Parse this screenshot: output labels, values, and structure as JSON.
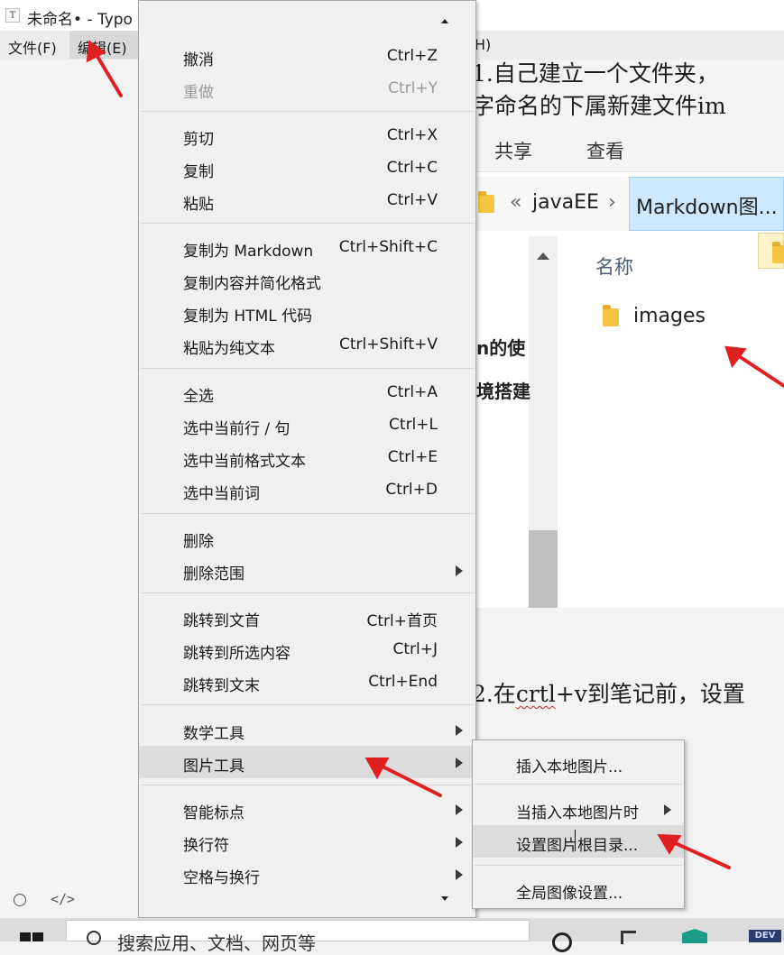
{
  "window": {
    "title": "未命名• - Typo",
    "app_icon_glyph": "T"
  },
  "menubar": {
    "items": [
      "文件(F)",
      "编辑(E)"
    ],
    "partial_item": "H)"
  },
  "document": {
    "line1": "1.自己建立一个文件夹，",
    "line1b": "字命名的下属新建文件im",
    "line2_prefix": "2.在",
    "line2_word": "crtl",
    "line2_suffix": "+v到笔记前，设置",
    "behind_text_1": "n的使",
    "behind_text_2": "境搭建"
  },
  "explorer": {
    "tabs": [
      "共享",
      "查看"
    ],
    "address_chevron": "«",
    "address_parent": "javaEE",
    "address_sep": "›",
    "address_current": "Markdown图...",
    "column_name": "名称",
    "folder_name": "images"
  },
  "context_menu": {
    "scroll_up": "▲",
    "scroll_down": "▼",
    "groups": [
      [
        {
          "label": "撤消",
          "shortcut": "Ctrl+Z"
        },
        {
          "label": "重做",
          "shortcut": "Ctrl+Y",
          "disabled": true
        }
      ],
      [
        {
          "label": "剪切",
          "shortcut": "Ctrl+X"
        },
        {
          "label": "复制",
          "shortcut": "Ctrl+C"
        },
        {
          "label": "粘贴",
          "shortcut": "Ctrl+V"
        }
      ],
      [
        {
          "label": "复制为 Markdown",
          "shortcut": "Ctrl+Shift+C"
        },
        {
          "label": "复制内容并简化格式",
          "shortcut": ""
        },
        {
          "label": "复制为 HTML 代码",
          "shortcut": ""
        },
        {
          "label": "粘贴为纯文本",
          "shortcut": "Ctrl+Shift+V"
        }
      ],
      [
        {
          "label": "全选",
          "shortcut": "Ctrl+A"
        },
        {
          "label": "选中当前行 / 句",
          "shortcut": "Ctrl+L"
        },
        {
          "label": "选中当前格式文本",
          "shortcut": "Ctrl+E"
        },
        {
          "label": "选中当前词",
          "shortcut": "Ctrl+D"
        }
      ],
      [
        {
          "label": "删除",
          "shortcut": ""
        },
        {
          "label": "删除范围",
          "shortcut": "",
          "submenu": true
        }
      ],
      [
        {
          "label": "跳转到文首",
          "shortcut": "Ctrl+首页"
        },
        {
          "label": "跳转到所选内容",
          "shortcut": "Ctrl+J"
        },
        {
          "label": "跳转到文末",
          "shortcut": "Ctrl+End"
        }
      ],
      [
        {
          "label": "数学工具",
          "shortcut": "",
          "submenu": true
        },
        {
          "label": "图片工具",
          "shortcut": "",
          "submenu": true,
          "highlighted": true
        }
      ],
      [
        {
          "label": "智能标点",
          "shortcut": "",
          "submenu": true
        },
        {
          "label": "换行符",
          "shortcut": "",
          "submenu": true
        },
        {
          "label": "空格与换行",
          "shortcut": "",
          "submenu": true
        }
      ]
    ]
  },
  "image_submenu": {
    "items": [
      {
        "label": "插入本地图片..."
      },
      {
        "label": "当插入本地图片时",
        "submenu": true
      },
      {
        "label": "设置图片根目录...",
        "highlighted": true
      },
      {
        "label": "全局图像设置..."
      }
    ]
  },
  "statusbar": {
    "icons": [
      "circle-icon",
      "code-icon"
    ],
    "code_glyph": "</>"
  },
  "taskbar": {
    "search_text": "搜索应用、文档、网页等"
  },
  "colors": {
    "annotation_arrow": "#e02020",
    "selection_blue": "#cce8ff",
    "menu_highlight": "#dcdcdc"
  }
}
